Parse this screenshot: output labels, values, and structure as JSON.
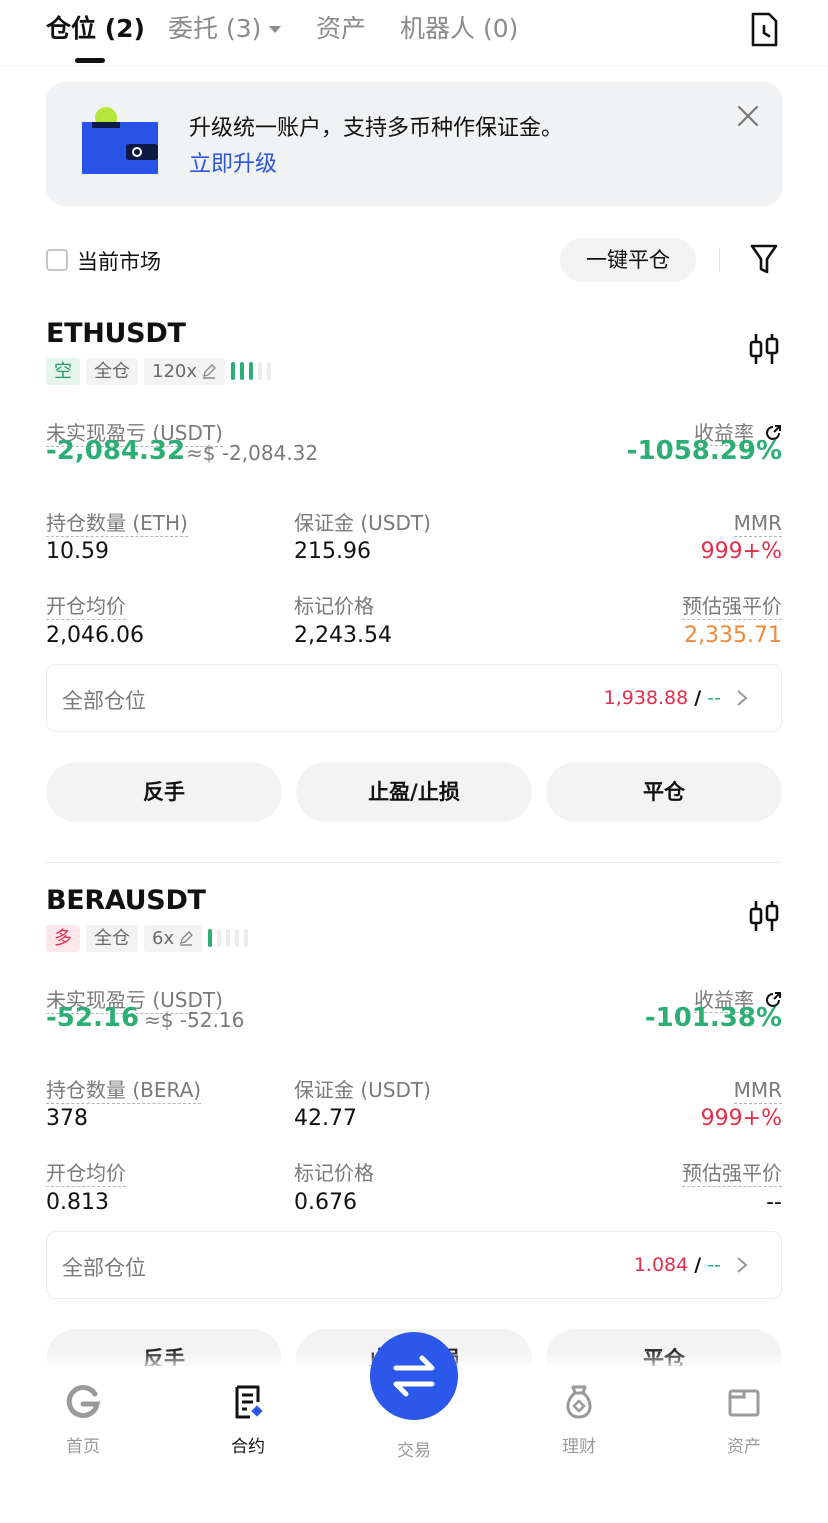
{
  "tabs": [
    {
      "label": "仓位 (2)",
      "active": true
    },
    {
      "label": "委托 (3)",
      "active": false
    },
    {
      "label": "资产",
      "active": false
    },
    {
      "label": "机器人 (0)",
      "active": false
    }
  ],
  "banner": {
    "text": "升级统一账户，支持多币种作保证金。",
    "link": "立即升级"
  },
  "filter": {
    "current_market_label": "当前市场",
    "current_market_checked": false,
    "close_all_label": "一键平仓"
  },
  "labels": {
    "unrealized_pnl": "未实现盈亏 (USDT)",
    "roi": "收益率",
    "margin": "保证金 (USDT)",
    "mmr": "MMR",
    "entry_price": "开仓均价",
    "mark_price": "标记价格",
    "liq_price": "预估强平价",
    "all_positions": "全部仓位",
    "reverse": "反手",
    "tp_sl": "止盈/止损",
    "close": "平仓"
  },
  "positions": [
    {
      "symbol": "ETHUSDT",
      "side": "空",
      "margin_mode": "全仓",
      "leverage": "120x",
      "risk_level": 3,
      "risk_max": 5,
      "pnl": "-2,084.32",
      "pnl_approx": "≈$ -2,084.32",
      "roi": "-1058.29%",
      "size_label": "持仓数量 (ETH)",
      "size": "10.59",
      "margin": "215.96",
      "mmr": "999+%",
      "entry_price": "2,046.06",
      "mark_price": "2,243.54",
      "liq_price": "2,335.71",
      "all_positions_value": "1,938.88",
      "all_positions_slash": "/",
      "all_positions_dash": "--"
    },
    {
      "symbol": "BERAUSDT",
      "side": "多",
      "margin_mode": "全仓",
      "leverage": "6x",
      "risk_level": 1,
      "risk_max": 5,
      "pnl": "-52.16",
      "pnl_approx": "≈$ -52.16",
      "roi": "-101.38%",
      "size_label": "持仓数量 (BERA)",
      "size": "378",
      "margin": "42.77",
      "mmr": "999+%",
      "entry_price": "0.813",
      "mark_price": "0.676",
      "liq_price": "--",
      "all_positions_value": "1.084",
      "all_positions_slash": "/",
      "all_positions_dash": "--"
    }
  ],
  "bottom_nav": [
    {
      "label": "首页",
      "icon": "home-icon",
      "active": false
    },
    {
      "label": "合约",
      "icon": "contract-icon",
      "active": true
    },
    {
      "label": "交易",
      "icon": "swap-icon",
      "active": false
    },
    {
      "label": "理财",
      "icon": "earn-icon",
      "active": false
    },
    {
      "label": "资产",
      "icon": "wallet-icon",
      "active": false
    }
  ],
  "colors": {
    "green": "#2dae74",
    "red": "#e0304b",
    "orange": "#f0883a",
    "blue": "#2b57ea"
  }
}
